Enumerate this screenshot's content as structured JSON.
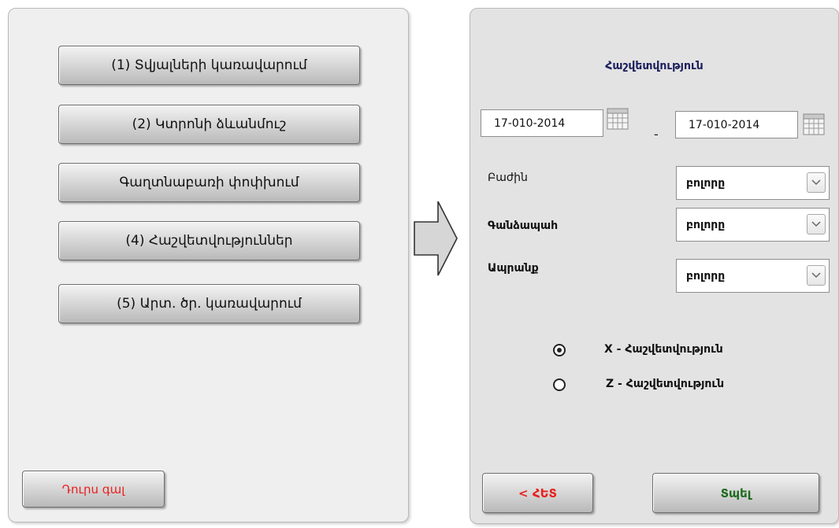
{
  "left_menu": {
    "items": [
      {
        "label": "(1) Տվյալների կառավարում"
      },
      {
        "label": "(2) Կտրոնի ձևանմուշ"
      },
      {
        "label": "Գաղտնաբառի փոփխում"
      },
      {
        "label": "(4) Հաշվետվություններ"
      },
      {
        "label": "(5) Արտ. ծր. կառավարում"
      }
    ],
    "exit_label": "Դուրս գալ"
  },
  "report_form": {
    "title": "Հաշվետվություն",
    "date_from": "17-010-2014",
    "date_to": "17-010-2014",
    "date_separator": "-",
    "department": {
      "label": "Բաժին",
      "value": "բոլորը"
    },
    "cashier": {
      "label": "Գանձապահ",
      "value": "բոլորը"
    },
    "product": {
      "label": "Ապրանք",
      "value": "բոլորը"
    },
    "report_types": [
      {
        "label": "X - Հաշվետվություն",
        "selected": true
      },
      {
        "label": "Z - Հաշվետվություն",
        "selected": false
      }
    ],
    "back_label": "< ՀԵՏ",
    "print_label": "Տպել"
  },
  "colors": {
    "exit_text": "#e8201e",
    "back_text": "#e8201e",
    "print_text": "#1f6b1f",
    "title_text": "#1b1f5b"
  }
}
